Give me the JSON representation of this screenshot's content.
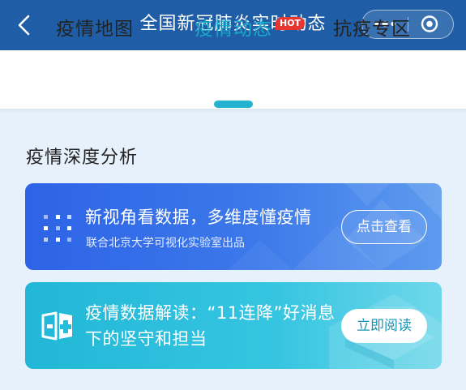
{
  "navbar": {
    "title": "全国新冠肺炎实时动态",
    "background": "#1f5ea6",
    "icons": [
      "back-chevron-icon",
      "more-dots-icon",
      "target-circle-icon"
    ]
  },
  "tabs": [
    {
      "label": "疫情地图",
      "active": false
    },
    {
      "label": "疫情动态",
      "active": true,
      "badge": "HOT"
    },
    {
      "label": "抗疫专区",
      "active": false
    }
  ],
  "accent_color": "#19a8c9",
  "section": {
    "title": "疫情深度分析",
    "cards": [
      {
        "title": "新视角看数据，多维度懂疫情",
        "subtitle": "联合北京大学可视化实验室出品",
        "button": "点击查看",
        "icon": "dot-grid-icon",
        "color": "#2d63e6"
      },
      {
        "title": "疫情数据解读：“11连降”好消息下的坚守和担当",
        "button": "立即阅读",
        "icon": "book-cross-icon",
        "color": "#22b7d7"
      }
    ]
  }
}
